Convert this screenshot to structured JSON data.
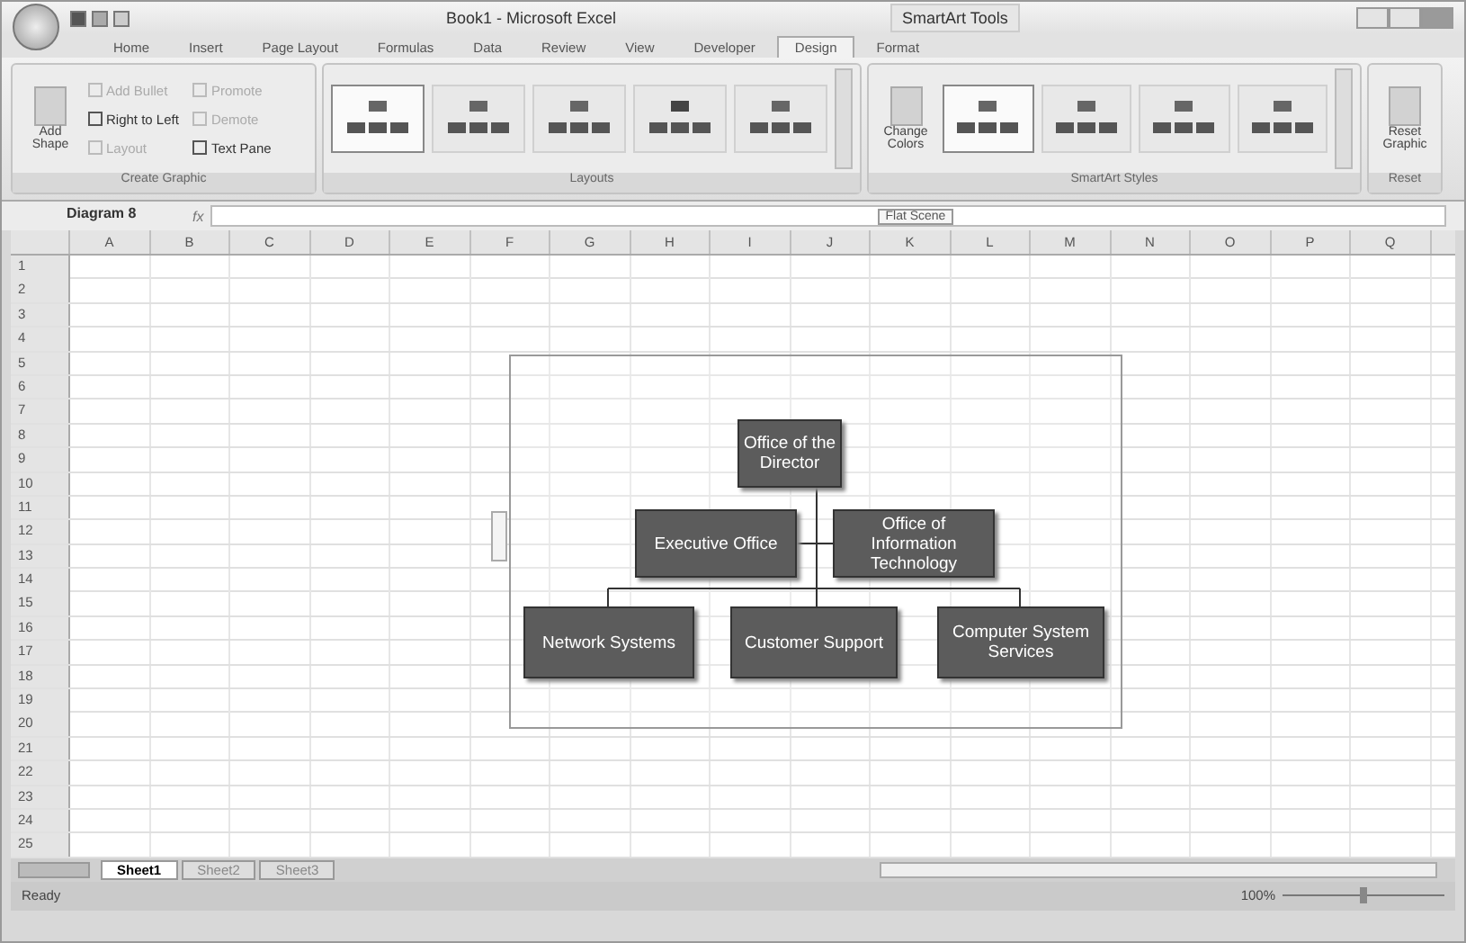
{
  "window": {
    "title": "Book1 - Microsoft Excel",
    "context_title": "SmartArt Tools"
  },
  "tabs": [
    {
      "label": "Home",
      "selected": false
    },
    {
      "label": "Insert",
      "selected": false
    },
    {
      "label": "Page Layout",
      "selected": false
    },
    {
      "label": "Formulas",
      "selected": false
    },
    {
      "label": "Data",
      "selected": false
    },
    {
      "label": "Review",
      "selected": false
    },
    {
      "label": "View",
      "selected": false
    },
    {
      "label": "Developer",
      "selected": false
    },
    {
      "label": "Design",
      "selected": true
    },
    {
      "label": "Format",
      "selected": false
    }
  ],
  "create_graphic": {
    "title": "Create Graphic",
    "add_shape": "Add Shape",
    "commands": [
      {
        "label": "Add Bullet",
        "disabled": true
      },
      {
        "label": "Right to Left",
        "disabled": false
      },
      {
        "label": "Layout",
        "disabled": true
      },
      {
        "label": "Promote",
        "disabled": true
      },
      {
        "label": "Demote",
        "disabled": true
      },
      {
        "label": "Text Pane",
        "disabled": false
      }
    ]
  },
  "layouts": {
    "title": "Layouts",
    "items": [
      {
        "selected": true
      },
      {
        "selected": false
      },
      {
        "selected": false
      },
      {
        "selected": false
      },
      {
        "selected": false
      }
    ]
  },
  "styles": {
    "title": "SmartArt Styles",
    "change_colors": "Change Colors",
    "items": [
      {
        "selected": true
      },
      {
        "selected": false
      },
      {
        "selected": false
      },
      {
        "selected": false
      }
    ]
  },
  "reset": {
    "title": "Reset",
    "button": "Reset Graphic"
  },
  "formula_bar": {
    "name_box": "Diagram 8",
    "fx": "fx",
    "tooltip": "Flat Scene"
  },
  "columns": [
    "A",
    "B",
    "C",
    "D",
    "E",
    "F",
    "G",
    "H",
    "I",
    "J",
    "K",
    "L",
    "M",
    "N",
    "O",
    "P",
    "Q"
  ],
  "rows": [
    "1",
    "2",
    "3",
    "4",
    "5",
    "6",
    "7",
    "8",
    "9",
    "10",
    "11",
    "12",
    "13",
    "14",
    "15",
    "16",
    "17",
    "18",
    "19",
    "20",
    "21",
    "22",
    "23",
    "24",
    "25"
  ],
  "org_chart": {
    "top": "Office of the Director",
    "assistants": [
      "Executive Office",
      "Office of Information Technology"
    ],
    "units": [
      "Network Systems",
      "Customer Support",
      "Computer System Services"
    ]
  },
  "sheets": [
    {
      "label": "Sheet1",
      "selected": true
    },
    {
      "label": "Sheet2",
      "selected": false
    },
    {
      "label": "Sheet3",
      "selected": false
    }
  ],
  "status_bar": {
    "status": "Ready",
    "zoom": "100%",
    "level": 0.5
  }
}
